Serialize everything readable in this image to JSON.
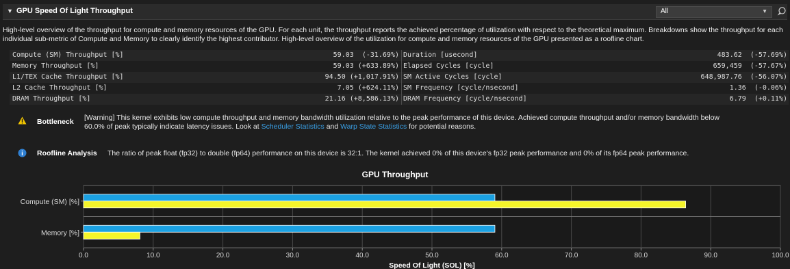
{
  "section": {
    "title": "GPU Speed Of Light Throughput",
    "filter_value": "All",
    "description": "High-level overview of the throughput for compute and memory resources of the GPU. For each unit, the throughput reports the achieved percentage of utilization with respect to the theoretical maximum. Breakdowns show the throughput for each individual sub-metric of Compute and Memory to clearly identify the highest contributor. High-level overview of the utilization for compute and memory resources of the GPU presented as a roofline chart."
  },
  "metrics": {
    "rows": [
      {
        "lname": "Compute (SM) Throughput [%]",
        "lval": "59.03",
        "ldiff": "(-31.69%)",
        "rname": "Duration [usecond]",
        "rval": "483.62",
        "rdiff": "(-57.69%)"
      },
      {
        "lname": "Memory Throughput [%]",
        "lval": "59.03",
        "ldiff": "(+633.89%)",
        "rname": "Elapsed Cycles [cycle]",
        "rval": "659,459",
        "rdiff": "(-57.67%)"
      },
      {
        "lname": "L1/TEX Cache Throughput [%]",
        "lval": "94.50",
        "ldiff": "(+1,017.91%)",
        "rname": "SM Active Cycles [cycle]",
        "rval": "648,987.76",
        "rdiff": "(-56.07%)"
      },
      {
        "lname": "L2 Cache Throughput [%]",
        "lval": "7.05",
        "ldiff": "(+624.11%)",
        "rname": "SM Frequency [cycle/nsecond]",
        "rval": "1.36",
        "rdiff": "(-0.06%)"
      },
      {
        "lname": "DRAM Throughput [%]",
        "lval": "21.16",
        "ldiff": "(+8,586.13%)",
        "rname": "DRAM Frequency [cycle/nsecond]",
        "rval": "6.79",
        "rdiff": "(+0.11%)"
      }
    ]
  },
  "bottleneck": {
    "label": "Bottleneck",
    "text_1": "[Warning] This kernel exhibits low compute throughput and memory bandwidth utilization relative to the peak performance of this device. Achieved compute throughput and/or memory bandwidth below",
    "text_2": "60.0% of peak typically indicate latency issues. Look at ",
    "link_1": "Scheduler Statistics",
    "text_3": " and ",
    "link_2": "Warp State Statistics",
    "text_4": " for potential reasons."
  },
  "roofline": {
    "label": "Roofline Analysis",
    "text": "The ratio of peak float (fp32) to double (fp64) performance on this device is 32:1. The kernel achieved 0% of this device's fp32 peak performance and 0% of its fp64 peak performance."
  },
  "colors": {
    "current": "#1ba1e2",
    "baseline": "#f5f52a",
    "warning": "#f2c500",
    "info": "#2f7fd1",
    "link": "#3aa0e6"
  },
  "chart_data": {
    "type": "bar",
    "orientation": "horizontal",
    "title": "GPU Throughput",
    "xlabel": "Speed Of Light (SOL) [%]",
    "categories": [
      "Compute (SM) [%]",
      "Memory [%]"
    ],
    "series": [
      {
        "values": [
          59.03,
          59.03
        ],
        "color": "#1ba1e2"
      },
      {
        "values": [
          86.4,
          8.1
        ],
        "color": "#f5f52a"
      }
    ],
    "xlim": [
      0,
      100
    ],
    "xticks": [
      "0.0",
      "10.0",
      "20.0",
      "30.0",
      "40.0",
      "50.0",
      "60.0",
      "70.0",
      "80.0",
      "90.0",
      "100.0"
    ],
    "grid": true
  }
}
